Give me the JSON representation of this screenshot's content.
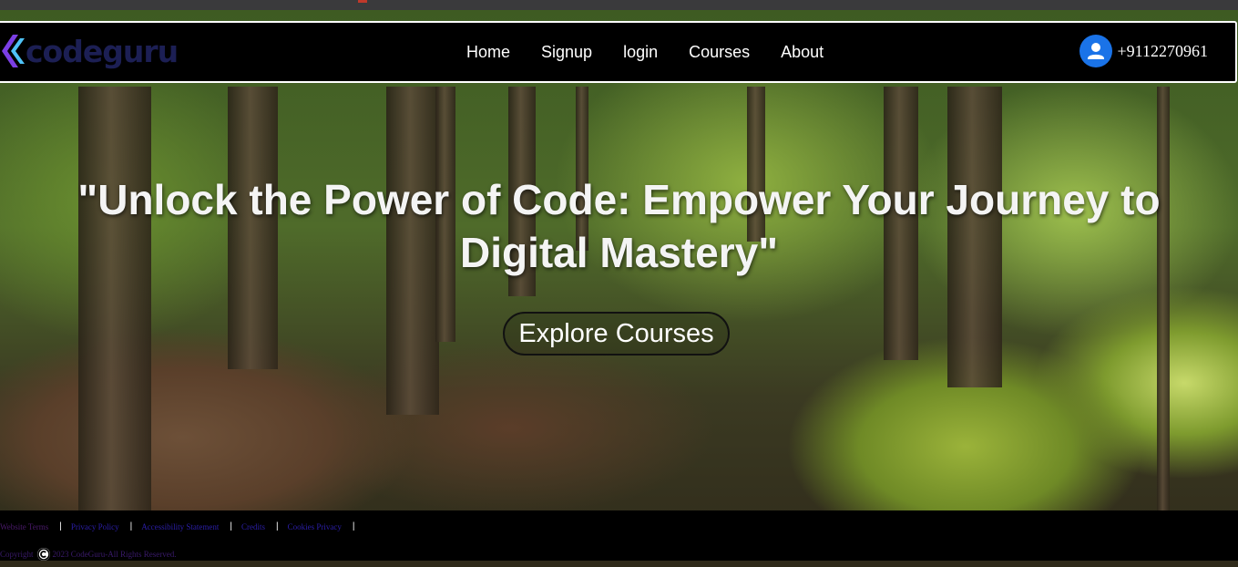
{
  "navbar": {
    "logo_text": "codeguru",
    "links": [
      "Home",
      "Signup",
      "login",
      "Courses",
      "About"
    ],
    "phone": "+9112270961"
  },
  "hero": {
    "title_line1": "\"Unlock the Power of Code: Empower Your Journey to",
    "title_line2": "Digital Mastery\"",
    "button_label": "Explore Courses"
  },
  "footer": {
    "links": [
      "Website Terms",
      "Privacy Policy",
      "Accessibility Statement",
      "Credits",
      "Cookies Privacy"
    ],
    "separator": "|",
    "copyright_label": "Copyright",
    "copyright_text": "2023 CodeGuru-All Rights Reserved."
  },
  "colors": {
    "navbar_bg": "#000000",
    "user_icon_bg": "#1a73e8",
    "logo_text": "#1c1f54",
    "footer_link": "#2b1ea8"
  },
  "icons": {
    "logo": "codeguru-logo-icon",
    "contact": "user-circle-icon",
    "copyright": "copyright-icon"
  }
}
